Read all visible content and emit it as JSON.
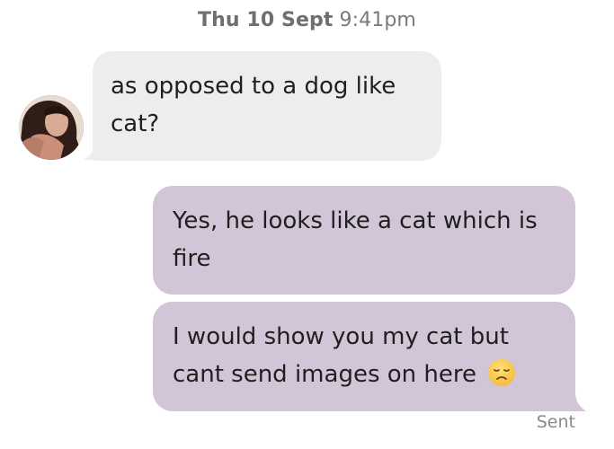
{
  "header": {
    "day": "Thu 10 Sept",
    "time": "9:41pm"
  },
  "messages": [
    {
      "direction": "incoming",
      "lines": [
        "as opposed to a dog like",
        "cat?"
      ]
    },
    {
      "direction": "outgoing",
      "lines": [
        "Yes, he looks like a cat which is",
        "fire"
      ]
    },
    {
      "direction": "outgoing",
      "lines": [
        "I would show you my cat but",
        "cant send images on here"
      ],
      "emoji": "disappointed-face"
    }
  ],
  "status": "Sent",
  "colors": {
    "incoming_bubble": "#ededed",
    "outgoing_bubble": "#d3c5d8",
    "timestamp_text": "#7a7a7a",
    "status_text": "#8a8a8a"
  }
}
